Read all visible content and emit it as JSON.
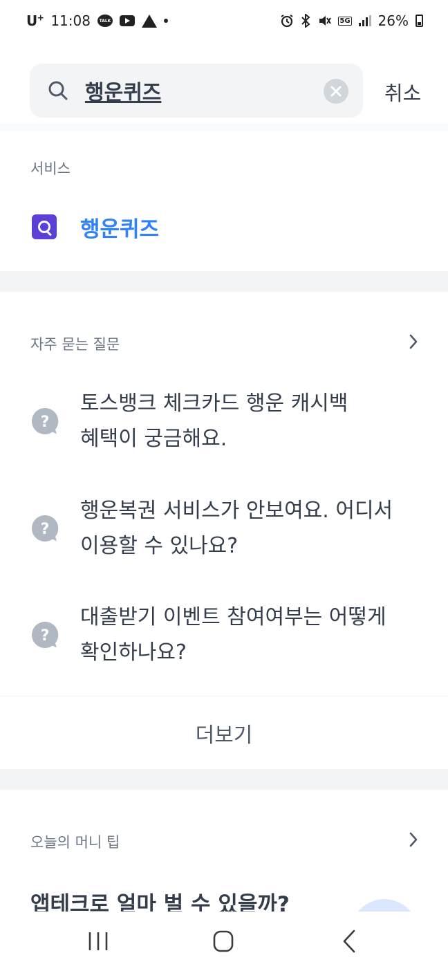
{
  "status_bar": {
    "carrier": "U",
    "carrier_sup": "+",
    "time": "11:08",
    "talk_label": "TALK",
    "network": "5G",
    "battery": "26%"
  },
  "search": {
    "query": "행운퀴즈",
    "cancel_label": "취소"
  },
  "services": {
    "section_label": "서비스",
    "items": [
      {
        "name": "행운퀴즈",
        "icon_letter": "Q",
        "icon_color": "#5b3fd7"
      }
    ]
  },
  "faq": {
    "section_label": "자주 묻는 질문",
    "items": [
      {
        "line1": "토스뱅크 체크카드 행운 캐시백",
        "line2": "혜택이 궁금해요."
      },
      {
        "line1": "행운복권 서비스가 안보여요. 어디서",
        "line2": "이용할 수 있나요?"
      },
      {
        "line1": "대출받기 이벤트 참여여부는 어떻게",
        "line2": "확인하나요?"
      }
    ],
    "more_label": "더보기"
  },
  "money_tip": {
    "section_label": "오늘의 머니 팁",
    "title": "앱테크로 얼마 벌 수 있을까?"
  },
  "colors": {
    "accent": "#3182f6",
    "text": "#333d4b",
    "subtext": "#6b7684",
    "divider": "#f2f4f6"
  }
}
